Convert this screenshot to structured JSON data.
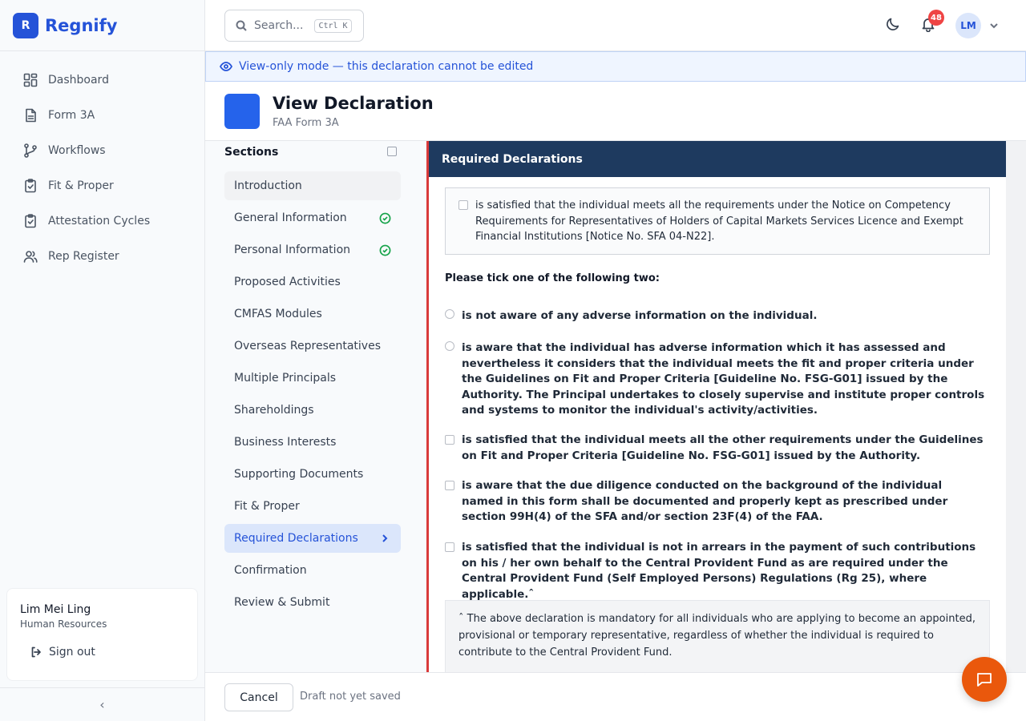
{
  "brand": {
    "logo_letter": "R",
    "name": "Regnify"
  },
  "nav": {
    "items": [
      {
        "label": "Dashboard",
        "icon": "dashboard-icon"
      },
      {
        "label": "Form 3A",
        "icon": "document-icon"
      },
      {
        "label": "Workflows",
        "icon": "git-branch-icon"
      },
      {
        "label": "Fit & Proper",
        "icon": "clipboard-check-icon"
      },
      {
        "label": "Attestation Cycles",
        "icon": "clipboard-check-icon"
      },
      {
        "label": "Rep Register",
        "icon": "users-icon"
      }
    ]
  },
  "user": {
    "name": "Lim Mei Ling",
    "role": "Human Resources",
    "signout_label": "Sign out"
  },
  "sidebar_collapse_glyph": "‹",
  "header": {
    "search_placeholder": "Search...",
    "search_shortcut": "Ctrl K",
    "notification_count": "48",
    "avatar_initials": "LM"
  },
  "banner": {
    "text": "View-only mode — this declaration cannot be edited"
  },
  "page": {
    "title": "View Declaration",
    "subtitle": "FAA Form 3A"
  },
  "sections": {
    "heading": "Sections",
    "items": [
      {
        "label": "Introduction",
        "state": "hover"
      },
      {
        "label": "General Information",
        "state": "complete"
      },
      {
        "label": "Personal Information",
        "state": "complete"
      },
      {
        "label": "Proposed Activities",
        "state": ""
      },
      {
        "label": "CMFAS Modules",
        "state": ""
      },
      {
        "label": "Overseas Representatives",
        "state": ""
      },
      {
        "label": "Multiple Principals",
        "state": ""
      },
      {
        "label": "Shareholdings",
        "state": ""
      },
      {
        "label": "Business Interests",
        "state": ""
      },
      {
        "label": "Supporting Documents",
        "state": ""
      },
      {
        "label": "Fit & Proper",
        "state": ""
      },
      {
        "label": "Required Declarations",
        "state": "active"
      },
      {
        "label": "Confirmation",
        "state": ""
      },
      {
        "label": "Review & Submit",
        "state": ""
      }
    ]
  },
  "declarations": {
    "heading": "Required Declarations",
    "competency_text": "is satisfied that the individual meets all the requirements under the Notice on Competency Requirements for Representatives of Holders of Capital Markets Services Licence and Exempt Financial Institutions [Notice No. SFA 04-N22].",
    "prompt": "Please tick one of the following two:",
    "radio_not_aware": "is not aware of any adverse information on the individual.",
    "radio_aware": "is aware that the individual has adverse information which it has assessed and nevertheless it considers that the individual meets the fit and proper criteria under the Guidelines on Fit and Proper Criteria [Guideline No. FSG-G01] issued by the Authority. The Principal undertakes to closely supervise and institute proper controls and systems to monitor the individual's activity/activities.",
    "check_other_requirements": "is satisfied that the individual meets all the other requirements under the Guidelines on Fit and Proper Criteria [Guideline No. FSG-G01] issued by the Authority.",
    "check_due_diligence": "is aware that the due diligence conducted on the background of the individual named in this form shall be documented and properly kept as prescribed under section 99H(4) of the SFA and/or section 23F(4) of the FAA.",
    "check_cpf": "is satisfied that the individual is not in arrears in the payment of such contributions on his / her own behalf to the Central Provident Fund as are required under the Central Provident Fund (Self Employed Persons) Regulations (Rg 25), where applicable.ˆ",
    "note": "ˆ The above declaration is mandatory for all individuals who are applying to become an appointed, provisional or temporary representative, regardless of whether the individual is required to contribute to the Central Provident Fund."
  },
  "footer": {
    "cancel_label": "Cancel",
    "status": "Draft not yet saved"
  },
  "colors": {
    "brand": "#2553d8",
    "declaration_header": "#1e3a5f",
    "accent_bar": "#d93a3a",
    "chat_button": "#ea580c",
    "complete": "#16a34a"
  }
}
